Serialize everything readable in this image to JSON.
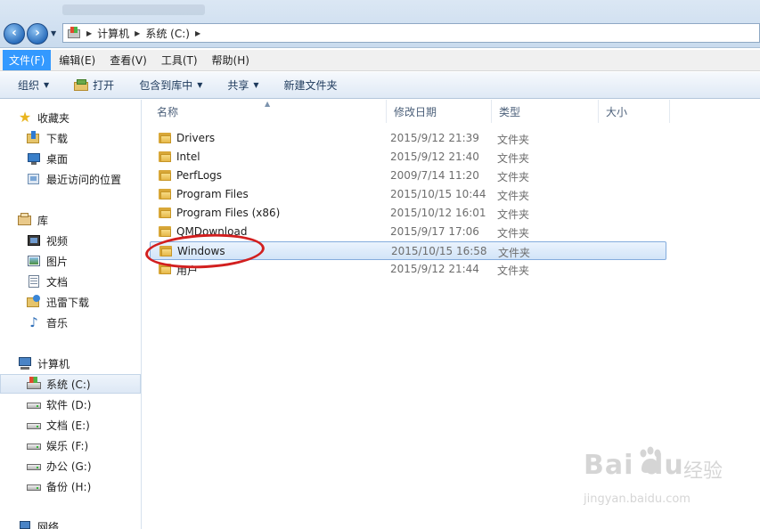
{
  "window": {
    "title": ""
  },
  "address": {
    "crumbs": [
      "计算机",
      "系统 (C:)"
    ]
  },
  "menu": {
    "items": [
      "文件(F)",
      "编辑(E)",
      "查看(V)",
      "工具(T)",
      "帮助(H)"
    ],
    "active_index": 0
  },
  "toolbar": {
    "organize": "组织",
    "open": "打开",
    "include_in_library": "包含到库中",
    "share": "共享",
    "new_folder": "新建文件夹"
  },
  "nav": {
    "favorites": "收藏夹",
    "downloads": "下载",
    "desktop": "桌面",
    "recent": "最近访问的位置",
    "libraries": "库",
    "videos": "视频",
    "pictures": "图片",
    "documents": "文档",
    "thunder": "迅雷下载",
    "music": "音乐",
    "computer": "计算机",
    "drive_c": "系统 (C:)",
    "drive_d": "软件 (D:)",
    "drive_e": "文档 (E:)",
    "drive_f": "娱乐 (F:)",
    "drive_g": "办公 (G:)",
    "drive_h": "备份 (H:)",
    "network": "网络"
  },
  "columns": {
    "name": "名称",
    "date": "修改日期",
    "type": "类型",
    "size": "大小"
  },
  "files": [
    {
      "name": "Drivers",
      "date": "2015/9/12 21:39",
      "type": "文件夹"
    },
    {
      "name": "Intel",
      "date": "2015/9/12 21:40",
      "type": "文件夹"
    },
    {
      "name": "PerfLogs",
      "date": "2009/7/14 11:20",
      "type": "文件夹"
    },
    {
      "name": "Program Files",
      "date": "2015/10/15 10:44",
      "type": "文件夹"
    },
    {
      "name": "Program Files (x86)",
      "date": "2015/10/12 16:01",
      "type": "文件夹"
    },
    {
      "name": "QMDownload",
      "date": "2015/9/17 17:06",
      "type": "文件夹"
    },
    {
      "name": "Windows",
      "date": "2015/10/15 16:58",
      "type": "文件夹"
    },
    {
      "name": "用户",
      "date": "2015/9/12 21:44",
      "type": "文件夹"
    }
  ],
  "selected_file_index": 6,
  "watermark": {
    "logo": "Bai du",
    "text": "经验",
    "url": "jingyan.baidu.com"
  },
  "colors": {
    "menu_active": "#3399ff",
    "annotation": "#d21f1f",
    "selection_border": "#84acdd"
  }
}
